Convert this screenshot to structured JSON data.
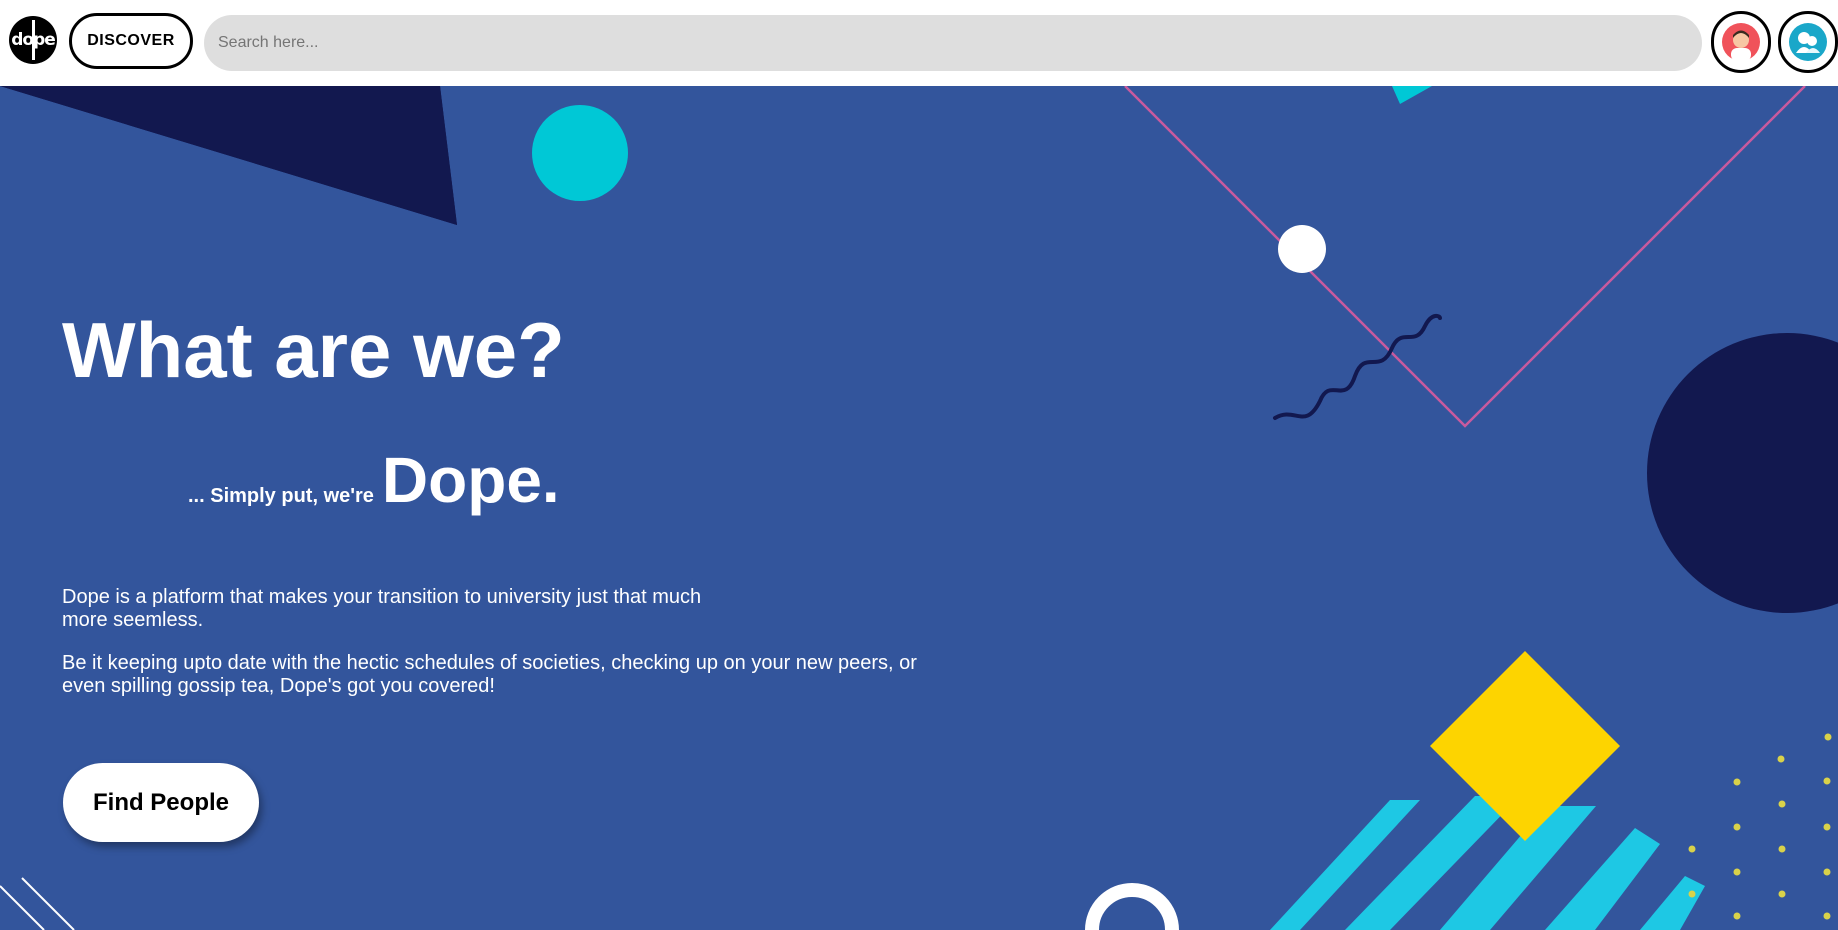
{
  "header": {
    "logo_text": "dope",
    "discover_label": "DISCOVER",
    "search_placeholder": "Search here..."
  },
  "hero": {
    "title": "What are we?",
    "tagline_small": "... Simply put, we're",
    "tagline_big": "Dope.",
    "desc1": "Dope is a platform that makes your transition to university just that much more seemless.",
    "desc2": "Be it keeping upto date with the hectic schedules of societies, checking up on your new peers, or even spilling gossip tea, Dope's got you covered!",
    "cta_label": "Find People"
  },
  "colors": {
    "hero_bg": "#33559c",
    "navy": "#12184f",
    "cyan": "#00c8d6",
    "yellow": "#fdd400",
    "stripe": "#1ec8e4",
    "pink_line": "#c85a9e",
    "search_bg": "#dedede"
  },
  "icons": [
    "profile-avatar-icon",
    "community-icon"
  ]
}
